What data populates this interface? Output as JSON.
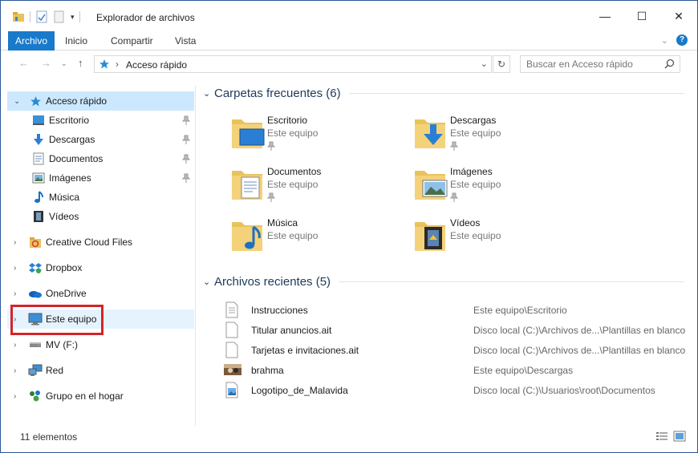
{
  "window": {
    "title": "Explorador de archivos",
    "controls": {
      "minimize": "—",
      "maximize": "☐",
      "close": "✕"
    }
  },
  "ribbon": {
    "tabs": [
      "Archivo",
      "Inicio",
      "Compartir",
      "Vista"
    ]
  },
  "address": {
    "crumb": "Acceso rápido",
    "search_placeholder": "Buscar en Acceso rápido"
  },
  "navpane": {
    "items": [
      {
        "label": "Acceso rápido",
        "icon": "star-icon",
        "level": 0,
        "expanded": true,
        "selected": true
      },
      {
        "label": "Escritorio",
        "icon": "desktop-icon",
        "level": 1,
        "pinned": true
      },
      {
        "label": "Descargas",
        "icon": "download-icon",
        "level": 1,
        "pinned": true
      },
      {
        "label": "Documentos",
        "icon": "document-icon",
        "level": 1,
        "pinned": true
      },
      {
        "label": "Imágenes",
        "icon": "picture-icon",
        "level": 1,
        "pinned": true
      },
      {
        "label": "Música",
        "icon": "music-icon",
        "level": 1
      },
      {
        "label": "Vídeos",
        "icon": "video-icon",
        "level": 1
      },
      {
        "label": "Creative Cloud Files",
        "icon": "creative-cloud-icon",
        "level": 0
      },
      {
        "label": "Dropbox",
        "icon": "dropbox-icon",
        "level": 0
      },
      {
        "label": "OneDrive",
        "icon": "onedrive-icon",
        "level": 0
      },
      {
        "label": "Este equipo",
        "icon": "computer-icon",
        "level": 0,
        "hover": true
      },
      {
        "label": "MV (F:)",
        "icon": "drive-icon",
        "level": 0
      },
      {
        "label": "Red",
        "icon": "network-icon",
        "level": 0
      },
      {
        "label": "Grupo en el hogar",
        "icon": "homegroup-icon",
        "level": 0
      }
    ]
  },
  "frequent": {
    "title": "Carpetas frecuentes (6)",
    "folders": [
      {
        "name": "Escritorio",
        "location": "Este equipo",
        "icon": "desktop-folder-icon"
      },
      {
        "name": "Descargas",
        "location": "Este equipo",
        "icon": "downloads-folder-icon"
      },
      {
        "name": "Documentos",
        "location": "Este equipo",
        "icon": "documents-folder-icon"
      },
      {
        "name": "Imágenes",
        "location": "Este equipo",
        "icon": "pictures-folder-icon"
      },
      {
        "name": "Música",
        "location": "Este equipo",
        "icon": "music-folder-icon"
      },
      {
        "name": "Vídeos",
        "location": "Este equipo",
        "icon": "videos-folder-icon"
      }
    ]
  },
  "recent": {
    "title": "Archivos recientes (5)",
    "files": [
      {
        "name": "Instrucciones",
        "path": "Este equipo\\Escritorio",
        "icon": "text-file-icon"
      },
      {
        "name": "Titular anuncios.ait",
        "path": "Disco local (C:)\\Archivos de...\\Plantillas en blanco",
        "icon": "blank-file-icon"
      },
      {
        "name": "Tarjetas e invitaciones.ait",
        "path": "Disco local (C:)\\Archivos de...\\Plantillas en blanco",
        "icon": "blank-file-icon"
      },
      {
        "name": "brahma",
        "path": "Este equipo\\Descargas",
        "icon": "image-thumbnail-icon"
      },
      {
        "name": "Logotipo_de_Malavida",
        "path": "Disco local (C:)\\Usuarios\\root\\Documentos",
        "icon": "image-file-icon"
      }
    ]
  },
  "status": {
    "count": "11 elementos"
  },
  "colors": {
    "accent": "#1979ca",
    "selection": "#cce8ff",
    "highlight_box": "#d3242a",
    "group_title": "#1e395b"
  }
}
